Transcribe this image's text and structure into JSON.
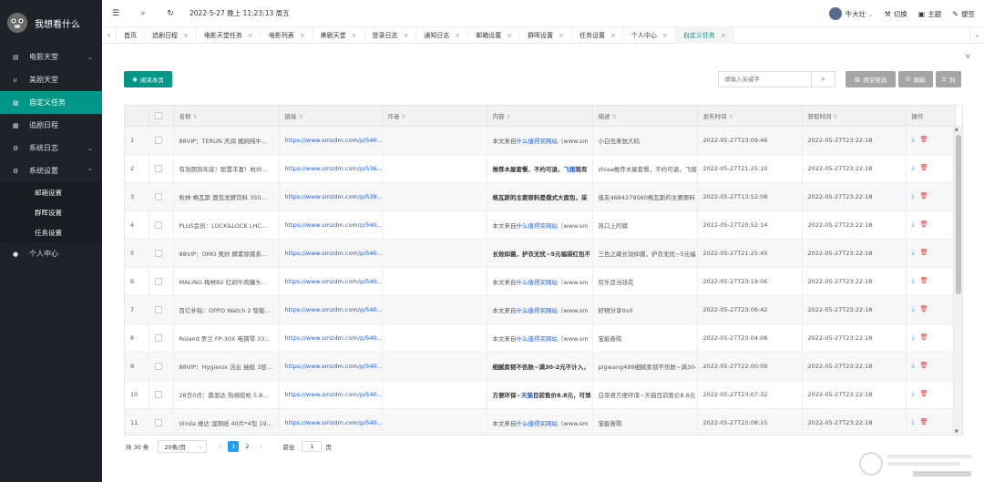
{
  "brand": {
    "title": "我想看什么"
  },
  "sidebar": {
    "items": [
      {
        "label": "电影天堂",
        "icon": "document-icon",
        "arrow": "⌄"
      },
      {
        "label": "美剧天堂",
        "icon": "magnet-icon",
        "arrow": ""
      },
      {
        "label": "自定义任务",
        "icon": "calendar-icon",
        "arrow": ""
      },
      {
        "label": "追剧日程",
        "icon": "calendar-icon",
        "arrow": ""
      },
      {
        "label": "系统日志",
        "icon": "gear-icon",
        "arrow": "⌄"
      },
      {
        "label": "系统设置",
        "icon": "gear-icon",
        "arrow": "⌃"
      }
    ],
    "subitems": [
      "邮箱设置",
      "群晖设置",
      "任务设置"
    ],
    "last": {
      "label": "个人中心",
      "icon": "user-icon"
    }
  },
  "topbar": {
    "datetime": "2022-5-27 晚上 11:23:13 周五",
    "username": "牛大壮",
    "switch_label": "切换",
    "theme_label": "主题",
    "note_label": "便签"
  },
  "tabs": [
    {
      "label": "首页",
      "closable": false
    },
    {
      "label": "追剧日程",
      "closable": true
    },
    {
      "label": "电影天堂任务",
      "closable": true
    },
    {
      "label": "电影列表",
      "closable": true
    },
    {
      "label": "美剧天堂",
      "closable": true
    },
    {
      "label": "登录日志",
      "closable": true
    },
    {
      "label": "通知日志",
      "closable": true
    },
    {
      "label": "邮箱设置",
      "closable": true
    },
    {
      "label": "群晖设置",
      "closable": true
    },
    {
      "label": "任务设置",
      "closable": true
    },
    {
      "label": "个人中心",
      "closable": true
    },
    {
      "label": "自定义任务",
      "closable": true
    }
  ],
  "toolbar": {
    "read_label": "阅读本页",
    "search_placeholder": "请输入关键字",
    "clear_label": "清空筛选",
    "refresh_label": "刷新",
    "columns_label": "列"
  },
  "table": {
    "headers": [
      "",
      "名称",
      "链接",
      "作者",
      "内容",
      "描述",
      "发布时间",
      "获取时间",
      "操作"
    ],
    "rows": [
      {
        "no": "1",
        "name": "88VIP：TERUN 天润 酱焖纯牛...",
        "link": "https://www.smzdm.com/p/540...",
        "author": "",
        "content_pre": "本文来自",
        "content_hl": "什么值得买网站",
        "content_post": "（www.sm",
        "content_bold": false,
        "desc": "小白也来张大码",
        "pub": "2022-05-27T23:09:46",
        "got": "2022-05-27T23:22:18"
      },
      {
        "no": "2",
        "name": "有效期到年底！配置丰富！杭州...",
        "link": "https://www.smzdm.com/p/536...",
        "author": "",
        "content_pre": "推荐木屋套餐，不约可退，",
        "content_hl": "飞猪",
        "content_post": "现有",
        "content_bold": true,
        "desc": "zhiaa推荐木屋套餐，不约可退，飞猪",
        "pub": "2022-05-27T21:25:10",
        "got": "2022-05-27T23:22:18"
      },
      {
        "no": "3",
        "name": "秋林·格瓦斯 面包发酵饮料 350...",
        "link": "https://www.smzdm.com/p/539...",
        "author": "",
        "content_pre": "格瓦斯的主要原料是俄式大面包，采",
        "content_hl": "",
        "content_post": "",
        "content_bold": true,
        "desc": "值友4684279560格瓦斯的主要原料",
        "pub": "2022-05-27T13:52:08",
        "got": "2022-05-27T23:22:18"
      },
      {
        "no": "4",
        "name": "PLUS会员：LOCK&LOCK LHC...",
        "link": "https://www.smzdm.com/p/540...",
        "author": "",
        "content_pre": "本文来自",
        "content_hl": "什么值得买网站",
        "content_post": "（www.sm",
        "content_bold": false,
        "desc": "风口上的猪",
        "pub": "2022-05-27T20:52:14",
        "got": "2022-05-27T23:22:18"
      },
      {
        "no": "5",
        "name": "88VIP：OMO 奥妙 酵素除菌系...",
        "link": "https://www.smzdm.com/p/540...",
        "author": "",
        "content_pre": "长效抑菌，护衣无忧~5元福袋红包不",
        "content_hl": "",
        "content_post": "",
        "content_bold": true,
        "desc": "三色之蔵长效抑菌，护衣无忧~5元福",
        "pub": "2022-05-27T21:25:45",
        "got": "2022-05-27T23:22:18"
      },
      {
        "no": "6",
        "name": "MALING 梅林B2 红焖牛肉罐头...",
        "link": "https://www.smzdm.com/p/540...",
        "author": "",
        "content_pre": "本文来自",
        "content_hl": "什么值得买网站",
        "content_post": "（www.sm",
        "content_bold": false,
        "desc": "欢乐豆当钱花",
        "pub": "2022-05-27T23:19:06",
        "got": "2022-05-27T23:22:18"
      },
      {
        "no": "7",
        "name": "百亿补贴：OPPO Watch 2 智能...",
        "link": "https://www.smzdm.com/p/540...",
        "author": "",
        "content_pre": "本文来自",
        "content_hl": "什么值得买网站",
        "content_post": "（www.sm",
        "content_bold": false,
        "desc": "好物分享0v0",
        "pub": "2022-05-27T23:06:42",
        "got": "2022-05-27T23:22:18"
      },
      {
        "no": "8",
        "name": "Roland 罗兰 FP-30X 电钢琴 33...",
        "link": "https://www.smzdm.com/p/540...",
        "author": "",
        "content_pre": "本文来自",
        "content_hl": "什么值得买网站",
        "content_post": "（www.sm",
        "content_bold": false,
        "desc": "宝能善购",
        "pub": "2022-05-27T23:04:08",
        "got": "2022-05-27T23:22:18"
      },
      {
        "no": "9",
        "name": "88VIP：Hygienix 洁云 抽纸 3层...",
        "link": "https://www.smzdm.com/p/540...",
        "author": "",
        "content_pre": "细腻柔韧不伤肤~满30-2元不计入，",
        "content_hl": "",
        "content_post": "",
        "content_bold": true,
        "desc": "pigwang499细腻柔韧不伤肤~满30-2",
        "pub": "2022-05-27T22:00:09",
        "got": "2022-05-27T23:22:18"
      },
      {
        "no": "10",
        "name": "28日0点：鼎恩达 热熔胶枪 5.8...",
        "link": "https://www.smzdm.com/p/540...",
        "author": "",
        "content_pre": "方便环保~",
        "content_hl": "天猫",
        "content_post": "目前售价8.8元，可领",
        "content_bold": true,
        "desc": "白菜君方便环保~天猫目前售价8.8元",
        "pub": "2022-05-27T23:07:32",
        "got": "2022-05-27T23:22:18"
      },
      {
        "no": "11",
        "name": "Vinda 维达 湿厕纸 40片*4包 19...",
        "link": "https://www.smzdm.com/p/540...",
        "author": "",
        "content_pre": "本文来自",
        "content_hl": "什么值得买网站",
        "content_post": "（www.sm",
        "content_bold": false,
        "desc": "宝能善购",
        "pub": "2022-05-27T23:08:15",
        "got": "2022-05-27T23:22:18"
      }
    ]
  },
  "pager": {
    "total": "共 30 条",
    "per_page": "20条/页",
    "prev": "‹",
    "pages": [
      "1",
      "2"
    ],
    "next": "›",
    "goto_label": "前往",
    "goto_value": "1",
    "page_unit": "页"
  }
}
